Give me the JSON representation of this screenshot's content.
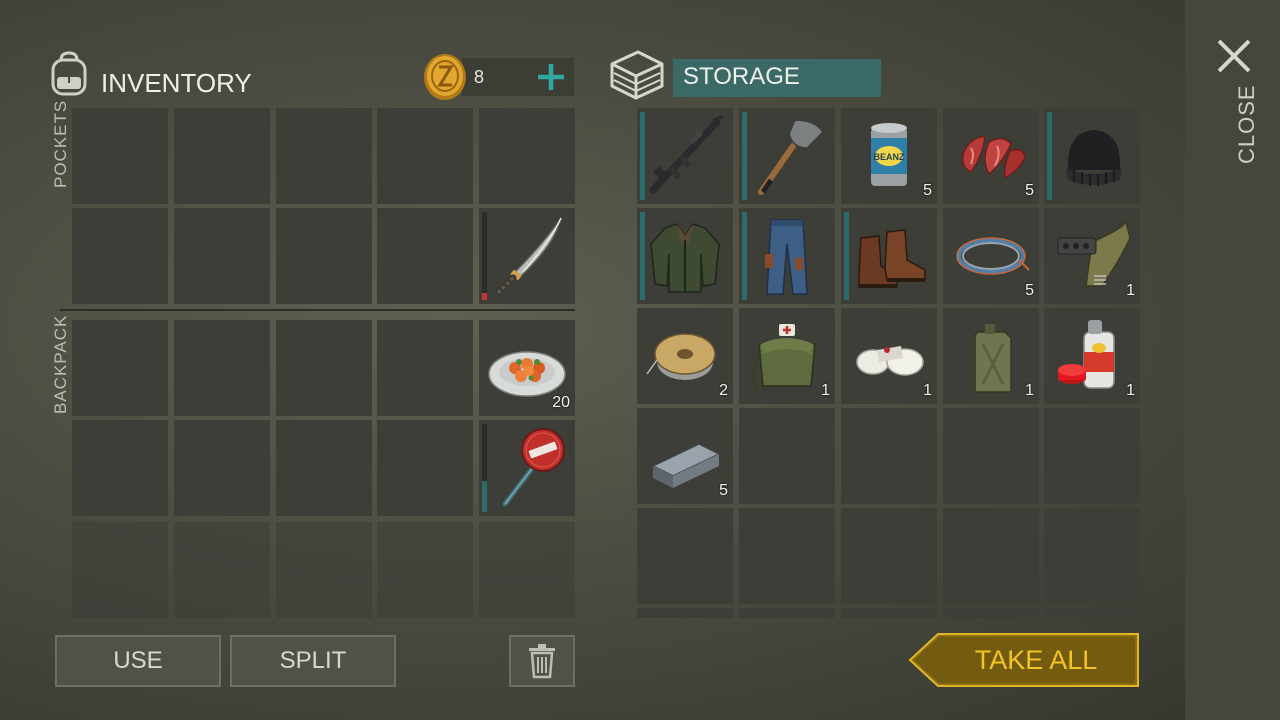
{
  "close": {
    "label": "CLOSE",
    "icon": "close-icon"
  },
  "inventory": {
    "title": "INVENTORY",
    "icon": "backpack-icon",
    "coins": "8",
    "coin_icon": "coin-icon",
    "add_icon": "plus-icon",
    "pockets_label": "POCKETS",
    "backpack_label": "BACKPACK",
    "items": [
      {
        "slot": "pocket-row2-col5",
        "name": "machete",
        "qty": "",
        "durability": 0.08,
        "durability_color": "#c0392b"
      },
      {
        "slot": "backpack-row1-col5",
        "name": "cooked-meal",
        "qty": "20"
      },
      {
        "slot": "backpack-row2-col5",
        "name": "stop-sign-club",
        "qty": "",
        "durability": 0.35,
        "durability_color": "#2a6b6b"
      }
    ]
  },
  "storage": {
    "title": "STORAGE",
    "icon": "storage-crate-icon",
    "items": [
      {
        "name": "assault-rifle",
        "qty": "",
        "equip": true
      },
      {
        "name": "shovel",
        "qty": "",
        "equip": true
      },
      {
        "name": "beanz-can",
        "qty": "5",
        "equip": false
      },
      {
        "name": "raw-meat",
        "qty": "5",
        "equip": false
      },
      {
        "name": "beanie-hat",
        "qty": "",
        "equip": true
      },
      {
        "name": "leather-jacket",
        "qty": "",
        "equip": true
      },
      {
        "name": "jeans",
        "qty": "",
        "equip": true
      },
      {
        "name": "boots",
        "qty": "",
        "equip": true
      },
      {
        "name": "wire-coil",
        "qty": "5",
        "equip": false
      },
      {
        "name": "weapon-parts",
        "qty": "1",
        "equip": false
      },
      {
        "name": "cable-spool",
        "qty": "2",
        "equip": false
      },
      {
        "name": "medical-bag",
        "qty": "1",
        "equip": false
      },
      {
        "name": "bandages",
        "qty": "1",
        "equip": false
      },
      {
        "name": "jerrycan",
        "qty": "1",
        "equip": false
      },
      {
        "name": "spray-paint",
        "qty": "1",
        "equip": false
      },
      {
        "name": "iron-ingot",
        "qty": "5",
        "equip": false
      }
    ]
  },
  "buttons": {
    "use": "USE",
    "split": "SPLIT",
    "trash_icon": "trash-icon",
    "take_all": "TAKE ALL"
  },
  "colors": {
    "accent_teal": "#3b6a66",
    "plus_teal": "#2ea8a0",
    "take_all_gold": "#f4c423",
    "slot_bg": "#3d3e38"
  }
}
